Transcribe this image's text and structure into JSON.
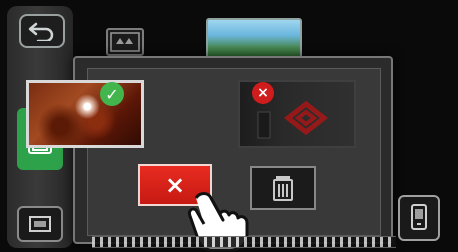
{
  "icons": {
    "back": "undo-icon",
    "save": "save-disk-icon",
    "frame": "frame-icon",
    "folder": "folder-thumb-icon",
    "check": "check-icon",
    "close": "close-icon",
    "trash": "trash-icon",
    "device": "device-icon",
    "hand": "hand-pointer-icon"
  },
  "colors": {
    "background": "#0a0a0a",
    "sidebar": "#2b2b2b",
    "accent_green": "#2ea24a",
    "cancel_red": "#d62218",
    "dialog": "#393939"
  },
  "dialog": {
    "cancel_symbol": "×",
    "check_symbol": "✓",
    "x_symbol": "×"
  }
}
